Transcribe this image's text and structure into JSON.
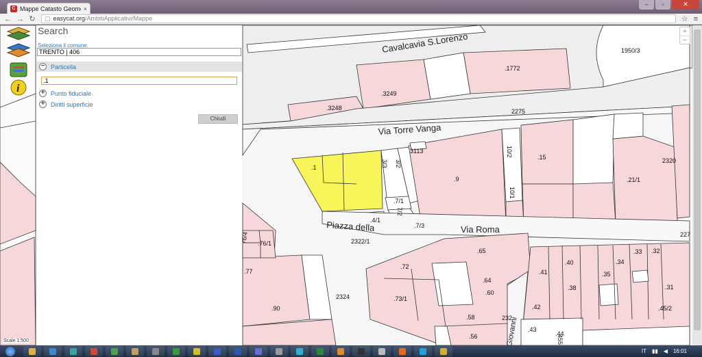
{
  "browser": {
    "tab_title": "Mappe Catasto Geometri",
    "tab_close": "×",
    "url_domain": "easycat.org",
    "url_path": "/AmbitiApplicativi/Mappe"
  },
  "panel": {
    "title": "Search",
    "comune_label": "Seleziona il comune:",
    "comune_value": "TRENTO | 406",
    "sections": [
      {
        "label": "Particella",
        "state": "open",
        "icon": "minus-icon"
      },
      {
        "label": "Punto fiduciale",
        "state": "closed",
        "icon": "plus-icon"
      },
      {
        "label": "Diritti superficie",
        "state": "closed",
        "icon": "plus-icon"
      }
    ],
    "particella_value": ".1",
    "close_button": "Chiudi"
  },
  "tools": [
    "layers-icon",
    "search-layers-icon",
    "legend-icon",
    "info-icon"
  ],
  "zoom": {
    "in": "+",
    "out": "−"
  },
  "scale_text": "Scale 1:500",
  "map": {
    "streets": [
      "Cavalcavia S.Lorenzo",
      "Via Torre Vanga",
      "Piazza della",
      "Via Roma",
      "Giovanni"
    ],
    "selected_parcel": ".1",
    "colors": {
      "parcel": "#f6d7da",
      "selected": "#f7f55a",
      "street": "#f5f5f5",
      "outline": "#333333"
    },
    "parcels": [
      ".1772",
      "1950/3",
      ".3249",
      ".3248",
      "2275",
      "3113",
      "10/2",
      ".15",
      "2320",
      ".9",
      "10/1",
      ".21/1",
      "3/3",
      "3/2",
      ".7/1",
      "7/2",
      ".4/1",
      ".7/3",
      "2322/1",
      "227",
      ".65",
      ".72",
      ".64",
      ".60",
      ".73/1",
      ".58",
      ".56",
      "232",
      ".40",
      ".41",
      ".38",
      ".42",
      ".35",
      ".34",
      ".33",
      ".32",
      ".31",
      ".45/2",
      ".44",
      ".43",
      "455",
      ".90",
      ".77",
      "2324",
      ".76/1",
      "76/4"
    ]
  },
  "taskbar": {
    "language": "IT",
    "time": "16:01"
  }
}
